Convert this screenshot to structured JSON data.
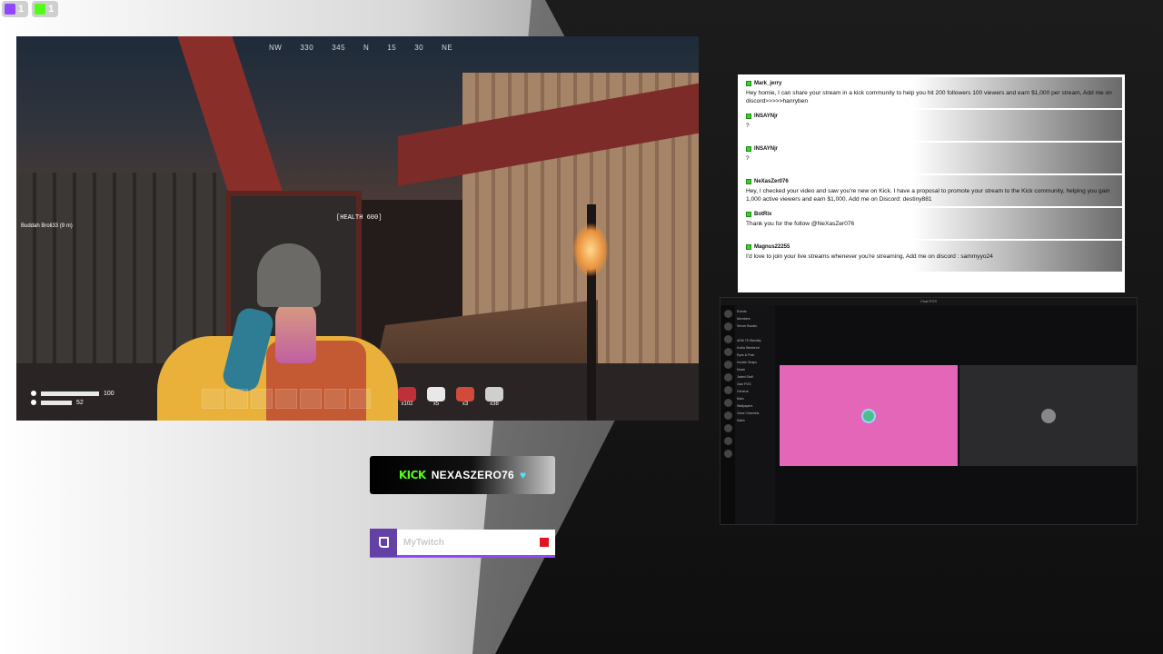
{
  "badges": [
    {
      "platform": "twitch",
      "count": "1"
    },
    {
      "platform": "kick",
      "count": "1"
    }
  ],
  "game": {
    "compass": [
      "NW",
      "330",
      "345",
      "N",
      "15",
      "30",
      "NE"
    ],
    "player_tag": "Buddah Broli33 (9 m)",
    "health_label": "[HEALTH 600]",
    "hud": {
      "health": "100",
      "stamina": "52"
    },
    "items": [
      {
        "icon": "berries-icon",
        "count": "x102",
        "color": "#c0303a"
      },
      {
        "icon": "syringe-icon",
        "count": "x5",
        "color": "#e8e8e8"
      },
      {
        "icon": "bandage-icon",
        "count": "x3",
        "color": "#d24a3a"
      },
      {
        "icon": "ammo-icon",
        "count": "x38",
        "color": "#cfcfcf"
      }
    ]
  },
  "chat": {
    "messages": [
      {
        "user": "Mark_jerry",
        "text": "Hey homie, I can share your stream in a kick community to help you hit 200 followers 100 viewers and earn $1,000 per stream, Add me on discord>>>>>hanryben"
      },
      {
        "user": "INSAYNjr",
        "text": "?"
      },
      {
        "user": "INSAYNjr",
        "text": "?"
      },
      {
        "user": "NeXasZer076",
        "text": "Hey, I checked your video and saw you're new on Kick. I have a proposal to promote your stream to the Kick community, helping you gain 1,000 active viewers and earn $1,000. Add me on Discord: destiny881"
      },
      {
        "user": "BotRix",
        "text": "Thank you for the follow @NeXasZer076"
      },
      {
        "user": "Magnus22255",
        "text": "I'd love to join your live streams whenever you're streaming, Add me on discord : sammyyo24"
      }
    ]
  },
  "discord": {
    "title": "Chat PGS",
    "channels": [
      "Events",
      "Members",
      "Server Boosts",
      "",
      "ADM 75 Standby",
      "Kodia Weekend",
      "Eyes & Fear",
      "Hoodie Snaps",
      "Music",
      "Jaded Stuff",
      "Clan PGS",
      "General",
      "Main",
      "Wallpapers",
      "Voice Channels",
      "Sales"
    ]
  },
  "kick_label": {
    "brand": "KICK",
    "name": "NEXASZERO76",
    "heart": "♥"
  },
  "twitch_label": {
    "handle": "MyTwitch"
  }
}
